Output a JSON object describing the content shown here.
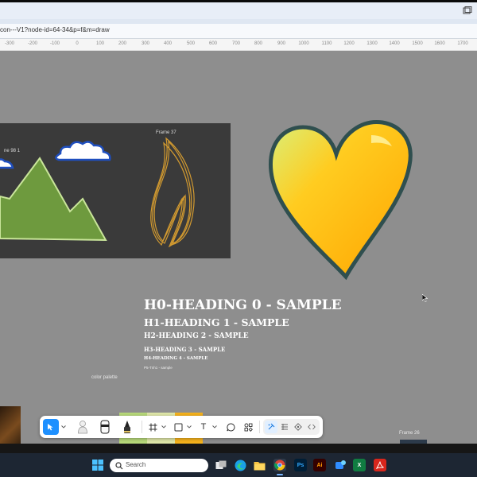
{
  "browser": {
    "url": "con---V1?node-id=64-34&p=f&m=draw"
  },
  "ruler": {
    "ticks": [
      "-300",
      "-200",
      "-100",
      "0",
      "100",
      "200",
      "300",
      "400",
      "500",
      "600",
      "700",
      "800",
      "900",
      "1000",
      "1100",
      "1200",
      "1300",
      "1400",
      "1500",
      "1600",
      "1700"
    ]
  },
  "canvas": {
    "frame_left_label": "ne 98 1",
    "frame37_label": "Frame 37",
    "headings": {
      "h0": "H0-HEADING 0 - SAMPLE",
      "h1": "H1-HEADING 1 - SAMPLE",
      "h2": "H2-HEADING 2 - SAMPLE",
      "h3": "H3-HEADING 3 - SAMPLE",
      "h4": "H4-HEADING 4 - SAMPLE",
      "h5": "P5-Tnh1 - sample"
    },
    "palette_label": "color palette",
    "frame26_label": "Frame 26",
    "colors": {
      "canvas_bg": "#8e8e8e",
      "mountain": "#6e9a3e",
      "heart_yellow": "#ffb000",
      "frame_dark": "#3a3a3a"
    }
  },
  "toolbar": {
    "tools": [
      {
        "name": "move-tool",
        "icon": "cursor-icon",
        "active": true
      },
      {
        "name": "figure-1",
        "icon": "avatar-icon"
      },
      {
        "name": "figure-2",
        "icon": "avatar-icon"
      },
      {
        "name": "figure-3",
        "icon": "pen-figure-icon"
      },
      {
        "name": "frame-tool",
        "icon": "hash-icon"
      },
      {
        "name": "shape-tool",
        "icon": "square-icon"
      },
      {
        "name": "text-tool",
        "icon": "text-icon",
        "glyph": "T"
      },
      {
        "name": "comment-tool",
        "icon": "comment-icon"
      },
      {
        "name": "components-tool",
        "icon": "components-icon"
      }
    ],
    "modes": [
      "draw-mode",
      "design-mode",
      "dev-mode",
      "code-mode"
    ]
  },
  "taskbar": {
    "search_placeholder": "Search",
    "apps": [
      "windows-start",
      "task-view",
      "edge",
      "file-explorer",
      "chrome",
      "photoshop",
      "illustrator",
      "network",
      "excel",
      "acrobat"
    ]
  }
}
